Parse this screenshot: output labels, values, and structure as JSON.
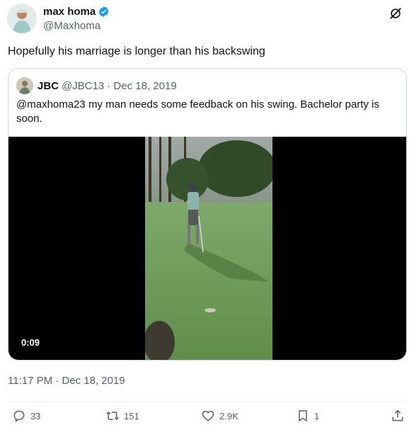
{
  "author": {
    "name": "max homa",
    "handle": "@Maxhoma"
  },
  "tweet": {
    "text": "Hopefully his marriage is longer than his backswing"
  },
  "quote": {
    "name": "JBC",
    "handle": "@JBC13",
    "date": "· Dec 18, 2019",
    "text": "@maxhoma23 my man needs some feedback on his swing. Bachelor party is soon.",
    "video_duration": "0:09"
  },
  "timestamp": "11:17 PM · Dec 18, 2019",
  "actions": {
    "replies": "33",
    "reposts": "151",
    "likes": "2.9K",
    "bookmarks": "1"
  },
  "colors": {
    "verified": "#1d9bf0",
    "secondary_text": "#536471",
    "border": "#cfd9de"
  }
}
